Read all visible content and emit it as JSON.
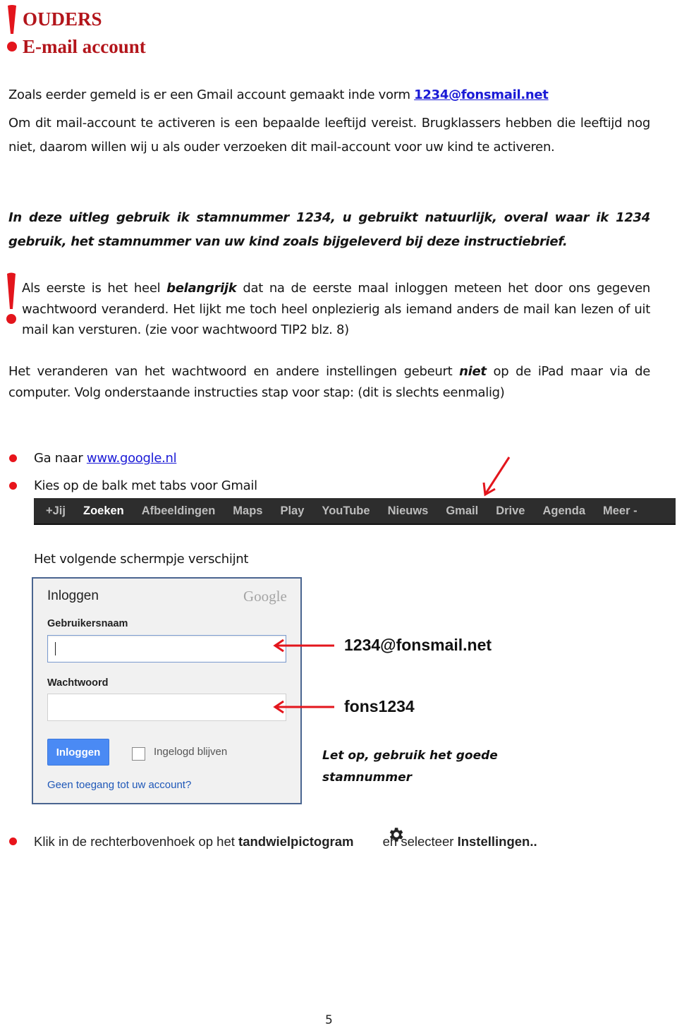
{
  "header": {
    "title_line1": "OUDERS",
    "title_line2": "E-mail account",
    "icon": "exclamation-icon"
  },
  "intro": {
    "line1_prefix": "Zoals eerder gemeld is er een Gmail account gemaakt inde vorm ",
    "email_link": "1234@fonsmail.net",
    "paragraph": "Om dit mail-account te activeren is een bepaalde leeftijd vereist. Brugklassers hebben die leeftijd nog niet, daarom willen wij u als ouder verzoeken dit mail-account voor uw kind te activeren."
  },
  "note": {
    "text": "In deze uitleg gebruik ik stamnummer 1234, u gebruikt natuurlijk, overal waar ik 1234 gebruik,  het stamnummer van uw kind zoals bijgeleverd bij deze instructiebrief."
  },
  "warning": {
    "icon": "exclamation-icon",
    "part1": "Als eerste is het heel ",
    "emphasis": "belangrijk",
    "part2": " dat na de eerste maal inloggen meteen het door ons gegeven wachtwoord veranderd. Het lijkt me toch heel onplezierig als iemand anders de mail kan lezen of uit mail kan versturen. (zie voor wachtwoord TIP2 blz. 8)"
  },
  "instructions": {
    "part1": "Het veranderen van het wachtwoord en andere instellingen gebeurt ",
    "emphasis": "niet",
    "part2": " op de iPad maar via de computer. Volg onderstaande instructies stap voor stap: (dit is slechts eenmalig)"
  },
  "steps": [
    {
      "prefix": "Ga naar ",
      "link": "www.google.nl"
    },
    {
      "text": "Kies op de balk met tabs voor Gmail"
    }
  ],
  "google_bar": {
    "items": [
      {
        "label": "+Jij",
        "active": false
      },
      {
        "label": "Zoeken",
        "active": true
      },
      {
        "label": "Afbeeldingen",
        "active": false
      },
      {
        "label": "Maps",
        "active": false
      },
      {
        "label": "Play",
        "active": false
      },
      {
        "label": "YouTube",
        "active": false
      },
      {
        "label": "Nieuws",
        "active": false
      },
      {
        "label": "Gmail",
        "active": false
      },
      {
        "label": "Drive",
        "active": false
      },
      {
        "label": "Agenda",
        "active": false
      },
      {
        "label": "Meer -",
        "active": false
      }
    ]
  },
  "screen_caption": "Het volgende schermpje verschijnt",
  "login": {
    "title": "Inloggen",
    "logo": "Google",
    "username_label": "Gebruikersnaam",
    "username_value": "",
    "password_label": "Wachtwoord",
    "password_value": "",
    "submit_label": "Inloggen",
    "remember_label": "Ingelogd blijven",
    "remember_checked": false,
    "help_link": "Geen toegang tot uw account?"
  },
  "annotations": {
    "username_hint": "1234@fonsmail.net",
    "password_hint": "fons1234",
    "note_line1": "Let op, gebruik het goede",
    "note_line2": "stamnummer"
  },
  "settings_step": {
    "part1": "Klik in de rechterbovenhoek op het ",
    "bold1": "tandwielpictogram",
    "icon": "gear-icon",
    "part2": "en selecteer ",
    "bold2": "Instellingen.."
  },
  "footer": {
    "page_number": "5"
  },
  "colors": {
    "accent_red": "#e3151c",
    "heading_red": "#b3151b",
    "link_blue": "#1a1ad6",
    "google_blue": "#4a8af4"
  }
}
